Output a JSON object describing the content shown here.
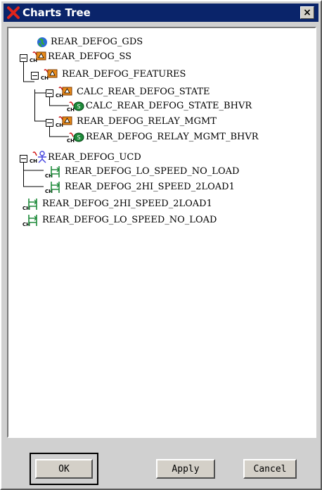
{
  "window": {
    "title": "Charts Tree",
    "close_glyph": "×"
  },
  "tree": {
    "nodes": [
      {
        "label": "REAR_DEFOG_GDS",
        "icon": "globe-icon",
        "has_expander": false,
        "has_ch": false
      },
      {
        "label": "REAR_DEFOG_SS",
        "icon": "state-chart-icon",
        "has_expander": true,
        "has_ch": true
      },
      {
        "label": "REAR_DEFOG_FEATURES",
        "icon": "state-chart-icon",
        "has_expander": true,
        "has_ch": true
      },
      {
        "label": "CALC_REAR_DEFOG_STATE",
        "icon": "state-chart-icon",
        "has_expander": true,
        "has_ch": true
      },
      {
        "label": "CALC_REAR_DEFOG_STATE_BHVR",
        "icon": "behavior-icon",
        "has_expander": false,
        "has_ch": true
      },
      {
        "label": "REAR_DEFOG_RELAY_MGMT",
        "icon": "state-chart-icon",
        "has_expander": true,
        "has_ch": true
      },
      {
        "label": "REAR_DEFOG_RELAY_MGMT_BHVR",
        "icon": "behavior-icon",
        "has_expander": false,
        "has_ch": true
      },
      {
        "label": "REAR_DEFOG_UCD",
        "icon": "actor-icon",
        "has_expander": true,
        "has_ch": true
      },
      {
        "label": "REAR_DEFOG_LO_SPEED_NO_LOAD",
        "icon": "sequence-icon",
        "has_expander": false,
        "has_ch": true
      },
      {
        "label": "REAR_DEFOG_2HI_SPEED_2LOAD1",
        "icon": "sequence-icon",
        "has_expander": false,
        "has_ch": true
      },
      {
        "label": "REAR_DEFOG_2HI_SPEED_2LOAD1",
        "icon": "sequence-icon",
        "has_expander": false,
        "has_ch": true
      },
      {
        "label": "REAR_DEFOG_LO_SPEED_NO_LOAD",
        "icon": "sequence-icon",
        "has_expander": false,
        "has_ch": true
      }
    ],
    "ch_marker": "CH"
  },
  "buttons": {
    "ok": "OK",
    "apply": "Apply",
    "cancel": "Cancel"
  },
  "colors": {
    "titlebar": "#0a246a",
    "state_icon": "#e88a1a",
    "behavior_icon": "#1e8a3a",
    "sequence_icon": "#1e8a3a",
    "actor_icon": "#4a4ae0",
    "link_arrow": "#d01010"
  }
}
